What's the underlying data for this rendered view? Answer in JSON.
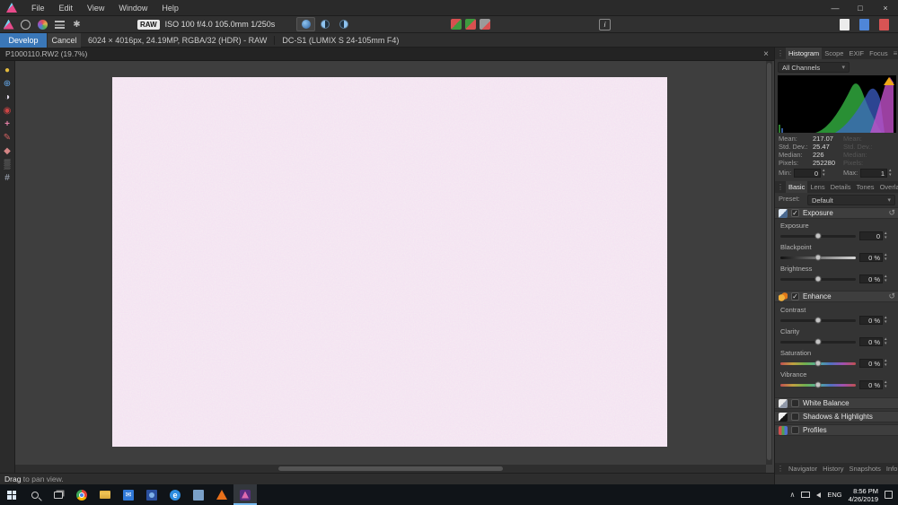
{
  "glyphs": {
    "up": "▴",
    "down": "▾",
    "dropdown": "▾",
    "reset": "↺",
    "menu": "≡",
    "grip": "⋮",
    "close": "×",
    "chevron_up": "∧",
    "info": "i"
  },
  "menu": {
    "items": [
      "File",
      "Edit",
      "View",
      "Window",
      "Help"
    ]
  },
  "window_controls": {
    "minimize": "—",
    "maximize": "□",
    "close": "×"
  },
  "toolbar": {
    "raw_badge": "RAW",
    "shot_info": "ISO 100 f/4.0 105.0mm 1/250s"
  },
  "context_bar": {
    "develop": "Develop",
    "cancel": "Cancel",
    "image_info": "6024 × 4016px, 24.19MP, RGBA/32 (HDR) - RAW",
    "camera_info": "DC-S1 (LUMIX S 24-105mm F4)"
  },
  "document_tab": {
    "title": "P1000110.RW2 (19.7%)"
  },
  "tools": [
    {
      "name": "view-tool",
      "glyph": "●"
    },
    {
      "name": "zoom-tool",
      "glyph": "⊕"
    },
    {
      "name": "white-balance-tool",
      "glyph": "◑"
    },
    {
      "name": "red-eye-removal-tool",
      "glyph": "◉"
    },
    {
      "name": "blemish-removal-tool",
      "glyph": "+"
    },
    {
      "name": "overlay-paint-tool",
      "glyph": "✎"
    },
    {
      "name": "overlay-erase-tool",
      "glyph": "◆"
    },
    {
      "name": "overlay-gradient-tool",
      "glyph": "▒"
    },
    {
      "name": "crop-tool",
      "glyph": "#"
    }
  ],
  "histogram_panel": {
    "tabs": [
      "Histogram",
      "Scope",
      "EXIF",
      "Focus"
    ],
    "channel": "All Channels",
    "stats": [
      {
        "label": "Mean:",
        "value": "217.07"
      },
      {
        "label": "Std. Dev.:",
        "value": "25.47"
      },
      {
        "label": "Median:",
        "value": "226"
      },
      {
        "label": "Pixels:",
        "value": "252280"
      }
    ],
    "ghost_labels": [
      "Mean:",
      "Std. Dev.:",
      "Median:",
      "Pixels:"
    ],
    "min_label": "Min:",
    "min_value": "0",
    "max_label": "Max:",
    "max_value": "1"
  },
  "develop_panel": {
    "tabs": [
      "Basic",
      "Lens",
      "Details",
      "Tones",
      "Overlays"
    ],
    "preset_label": "Preset:",
    "preset_value": "Default",
    "groups": {
      "exposure": {
        "title": "Exposure",
        "check": "✓"
      },
      "enhance": {
        "title": "Enhance",
        "check": "✓"
      },
      "white_balance": {
        "title": "White Balance",
        "check": ""
      },
      "shadows_highlights": {
        "title": "Shadows & Highlights",
        "check": ""
      },
      "profiles": {
        "title": "Profiles",
        "check": ""
      }
    },
    "sliders": {
      "exposure": {
        "label": "Exposure",
        "value": "0"
      },
      "blackpoint": {
        "label": "Blackpoint",
        "value": "0 %"
      },
      "brightness": {
        "label": "Brightness",
        "value": "0 %"
      },
      "contrast": {
        "label": "Contrast",
        "value": "0 %"
      },
      "clarity": {
        "label": "Clarity",
        "value": "0 %"
      },
      "saturation": {
        "label": "Saturation",
        "value": "0 %"
      },
      "vibrance": {
        "label": "Vibrance",
        "value": "0 %"
      }
    },
    "bottom_tabs": [
      "Navigator",
      "History",
      "Snapshots",
      "Info"
    ]
  },
  "status_bar": {
    "drag": "Drag",
    "rest": " to pan view."
  },
  "taskbar": {
    "edge_glyph": "e",
    "mail_glyph": "✉",
    "lang": "ENG",
    "time": "8:56 PM",
    "date": "4/26/2019"
  }
}
